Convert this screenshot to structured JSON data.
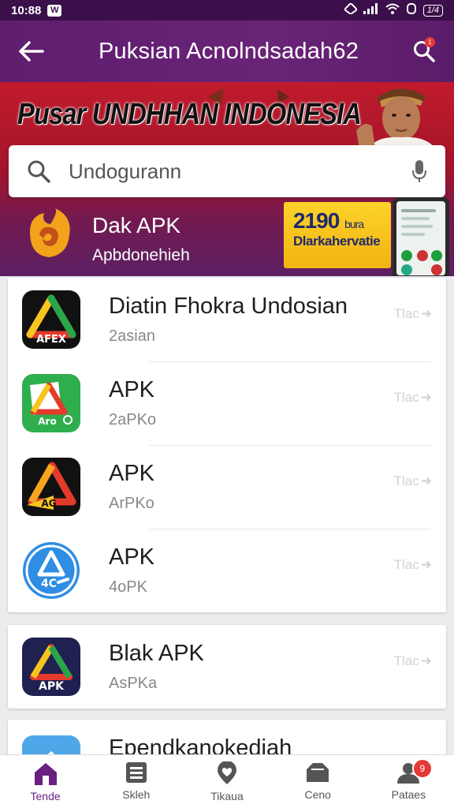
{
  "status_bar": {
    "time": "10:88",
    "battery": "1/4"
  },
  "app_bar": {
    "title": "Puksian Acnolndsadah62",
    "notification_count": "1"
  },
  "banner": {
    "headline": "Pusar UNDHHAN INDONESIA",
    "search_placeholder": "Undogurann",
    "promo_title": "Dak APK",
    "promo_subtitle": "Apbdonehieh",
    "promo_card_number": "2190",
    "promo_card_number_suffix": "bura",
    "promo_card_sub": "Dlarkahervatie"
  },
  "apps": [
    {
      "name": "Diatin Fhokra Undosian",
      "sub": "2asian",
      "action": "Tlac",
      "icon_text": "AFEX",
      "icon_bg": "#111111"
    },
    {
      "name": "APK",
      "sub": "2aPKo",
      "action": "Tlac",
      "icon_text": "Aro",
      "icon_bg": "#2fae4d"
    },
    {
      "name": "APK",
      "sub": "ArPKo",
      "action": "Tlac",
      "icon_text": "AG",
      "icon_bg": "#111111"
    },
    {
      "name": "APK",
      "sub": "4oPK",
      "action": "Tlac",
      "icon_text": "4C",
      "icon_bg": "#2f8de4"
    }
  ],
  "apps_second": [
    {
      "name": "Blak APK",
      "sub": "AsPKa",
      "action": "Tlac",
      "icon_text": "APK",
      "icon_bg": "#1f2150"
    }
  ],
  "apps_third": [
    {
      "name": "Ependkanokediah"
    }
  ],
  "bottom_nav": [
    {
      "label": "Tende",
      "icon": "home-icon",
      "active": true
    },
    {
      "label": "Skleh",
      "icon": "list-icon",
      "active": false
    },
    {
      "label": "Tikaua",
      "icon": "heart-location-icon",
      "active": false
    },
    {
      "label": "Ceno",
      "icon": "box-icon",
      "active": false
    },
    {
      "label": "Pataes",
      "icon": "profile-icon",
      "active": false,
      "badge": "9"
    }
  ],
  "colors": {
    "primary": "#5e1d6e",
    "accent_red": "#c01b2c",
    "promo_yellow": "#fcd22b",
    "badge_red": "#e53935"
  }
}
